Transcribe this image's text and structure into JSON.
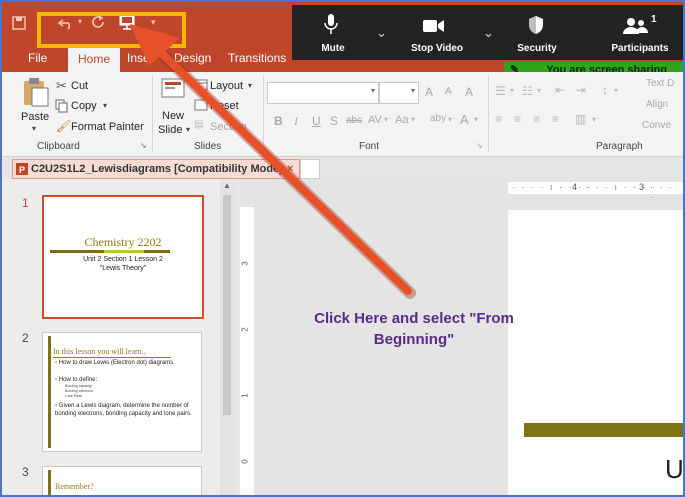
{
  "quick_access": {
    "save_icon": "save-icon",
    "undo_icon": "undo-icon",
    "redo_icon": "redo-icon",
    "present_icon": "present-from-beginning-icon",
    "customize_icon": "customize-dropdown-icon"
  },
  "tabs": [
    "File",
    "Home",
    "Inse",
    "Design",
    "Transitions"
  ],
  "zoom": {
    "mute": "Mute",
    "stop_video": "Stop Video",
    "security": "Security",
    "participants": "Participants",
    "participant_count": "1",
    "sharing_banner": "You are screen sharing"
  },
  "ribbon": {
    "clipboard": {
      "paste": "Paste",
      "cut": "Cut",
      "copy": "Copy",
      "format_painter": "Format Painter",
      "label": "Clipboard"
    },
    "slides": {
      "new_slide_line1": "New",
      "new_slide_line2": "Slide",
      "layout": "Layout",
      "reset": "Reset",
      "section": "Section",
      "label": "Slides"
    },
    "font": {
      "font_name": "",
      "font_size": "",
      "grow": "A",
      "shrink": "A",
      "clear": "A",
      "bold": "B",
      "italic": "I",
      "underline": "U",
      "shadow": "S",
      "strike": "abc",
      "spacing": "AV",
      "case": "Aa",
      "highlight": "aby",
      "color": "A",
      "label": "Font"
    },
    "paragraph": {
      "text_direction": "Text D",
      "align": "Align",
      "convert": "Conve",
      "label": "Paragraph"
    }
  },
  "document_tab": {
    "title": "C2U2S1L2_Lewisdiagrams [Compatibility Mode]",
    "close": "×"
  },
  "thumbnails": [
    {
      "number": "1",
      "title": "Chemistry 2202",
      "subtitle_line1": "Unit 2 Section 1 Lesson 2",
      "subtitle_line2": "\"Lewis Theory\""
    },
    {
      "number": "2",
      "title": "In this lesson you will learn..",
      "bullets": [
        "How to draw Lewis (Electron dot) diagrams.",
        "How to define:",
        "Given a Lewis diagram, determine the number of bonding electrons, bonding capacity and lone pairs."
      ],
      "sub_bullets": [
        "Bonding capacity",
        "Bonding electrons",
        "Lone Pairs"
      ]
    },
    {
      "number": "3",
      "title": "Remember?"
    }
  ],
  "ruler": {
    "h_marks": [
      "4",
      "3"
    ],
    "v_marks": [
      "3",
      "2",
      "1",
      "0"
    ]
  },
  "slide_main_letter": "U",
  "annotation": {
    "line1": "Click Here and select \"From",
    "line2": "Beginning\""
  },
  "colors": {
    "accent": "#c0462b",
    "highlight_box": "#f2b705",
    "arrow": "#e8502a",
    "annotation_text": "#5b2a86",
    "zoom_bar": "#232323",
    "sharing_green": "#2fa51c",
    "olive": "#807316"
  }
}
